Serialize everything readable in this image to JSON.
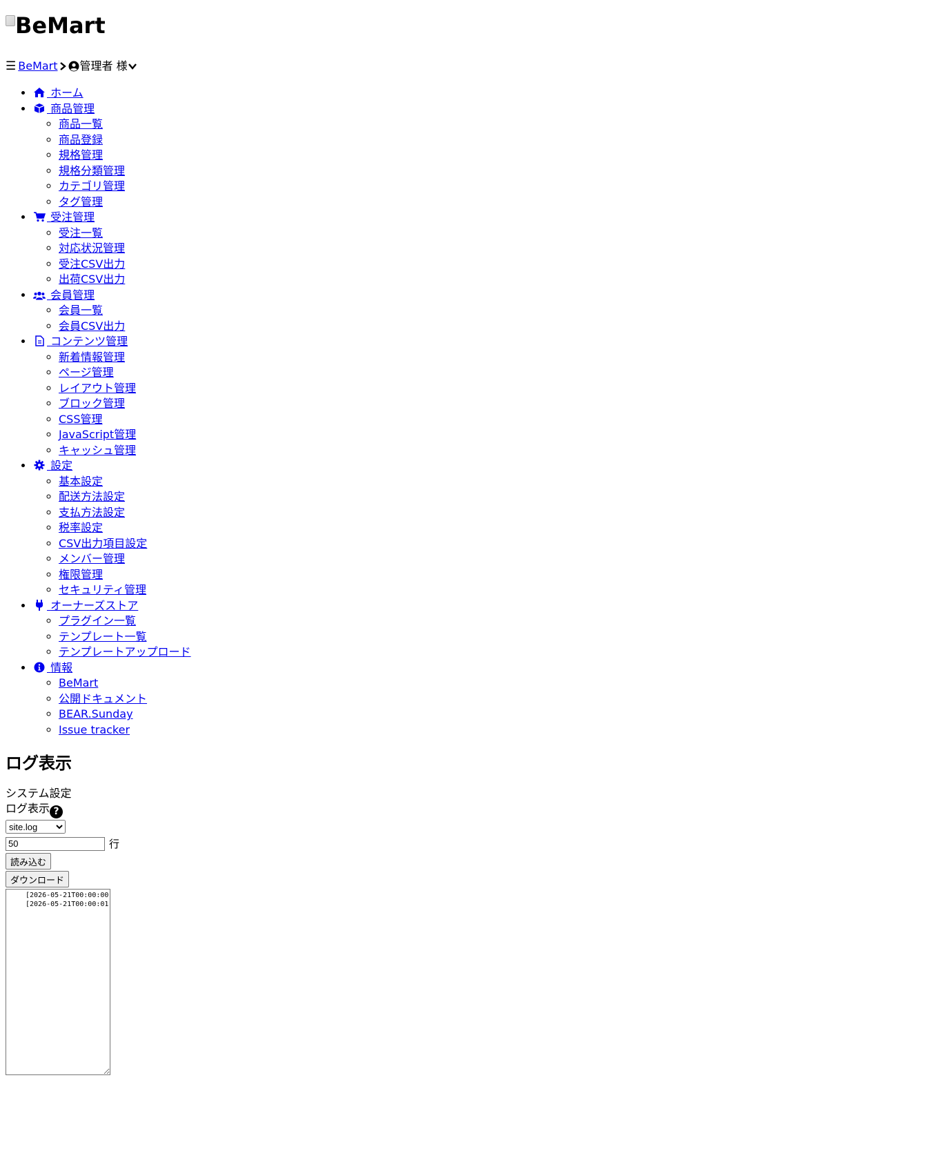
{
  "header": {
    "logo_text": "BeMart",
    "menu_icon": "☰",
    "breadcrumb_home": "BeMart",
    "user_label": "管理者 様"
  },
  "nav": [
    {
      "label": "ホーム",
      "icon": "home-icon",
      "children": []
    },
    {
      "label": "商品管理",
      "icon": "box-icon",
      "children": [
        "商品一覧",
        "商品登録",
        "規格管理",
        "規格分類管理",
        "カテゴリ管理",
        "タグ管理"
      ]
    },
    {
      "label": "受注管理",
      "icon": "cart-icon",
      "children": [
        "受注一覧",
        "対応状況管理",
        "受注CSV出力",
        "出荷CSV出力"
      ]
    },
    {
      "label": "会員管理",
      "icon": "users-icon",
      "children": [
        "会員一覧",
        "会員CSV出力"
      ]
    },
    {
      "label": "コンテンツ管理",
      "icon": "file-icon",
      "children": [
        "新着情報管理",
        "ページ管理",
        "レイアウト管理",
        "ブロック管理",
        "CSS管理",
        "JavaScript管理",
        "キャッシュ管理"
      ]
    },
    {
      "label": "設定",
      "icon": "gear-icon",
      "children": [
        "基本設定",
        "配送方法設定",
        "支払方法設定",
        "税率設定",
        "CSV出力項目設定",
        "メンバー管理",
        "権限管理",
        "セキュリティ管理"
      ]
    },
    {
      "label": "オーナーズストア",
      "icon": "plug-icon",
      "children": [
        "プラグイン一覧",
        "テンプレート一覧",
        "テンプレートアップロード"
      ]
    },
    {
      "label": "情報",
      "icon": "info-icon",
      "children": [
        "BeMart",
        "公開ドキュメント",
        "BEAR.Sunday",
        "Issue tracker"
      ]
    }
  ],
  "main": {
    "title": "ログ表示",
    "breadcrumb_parent": "システム設定",
    "breadcrumb_current": "ログ表示",
    "help_glyph": "?",
    "log_file_selected": "site.log",
    "lines_value": "50",
    "lines_unit": "行",
    "load_button": "読み込む",
    "download_button": "ダウンロード",
    "log_content": "[2026-05-21T00:00:00\n[2026-05-21T00:00:01"
  }
}
